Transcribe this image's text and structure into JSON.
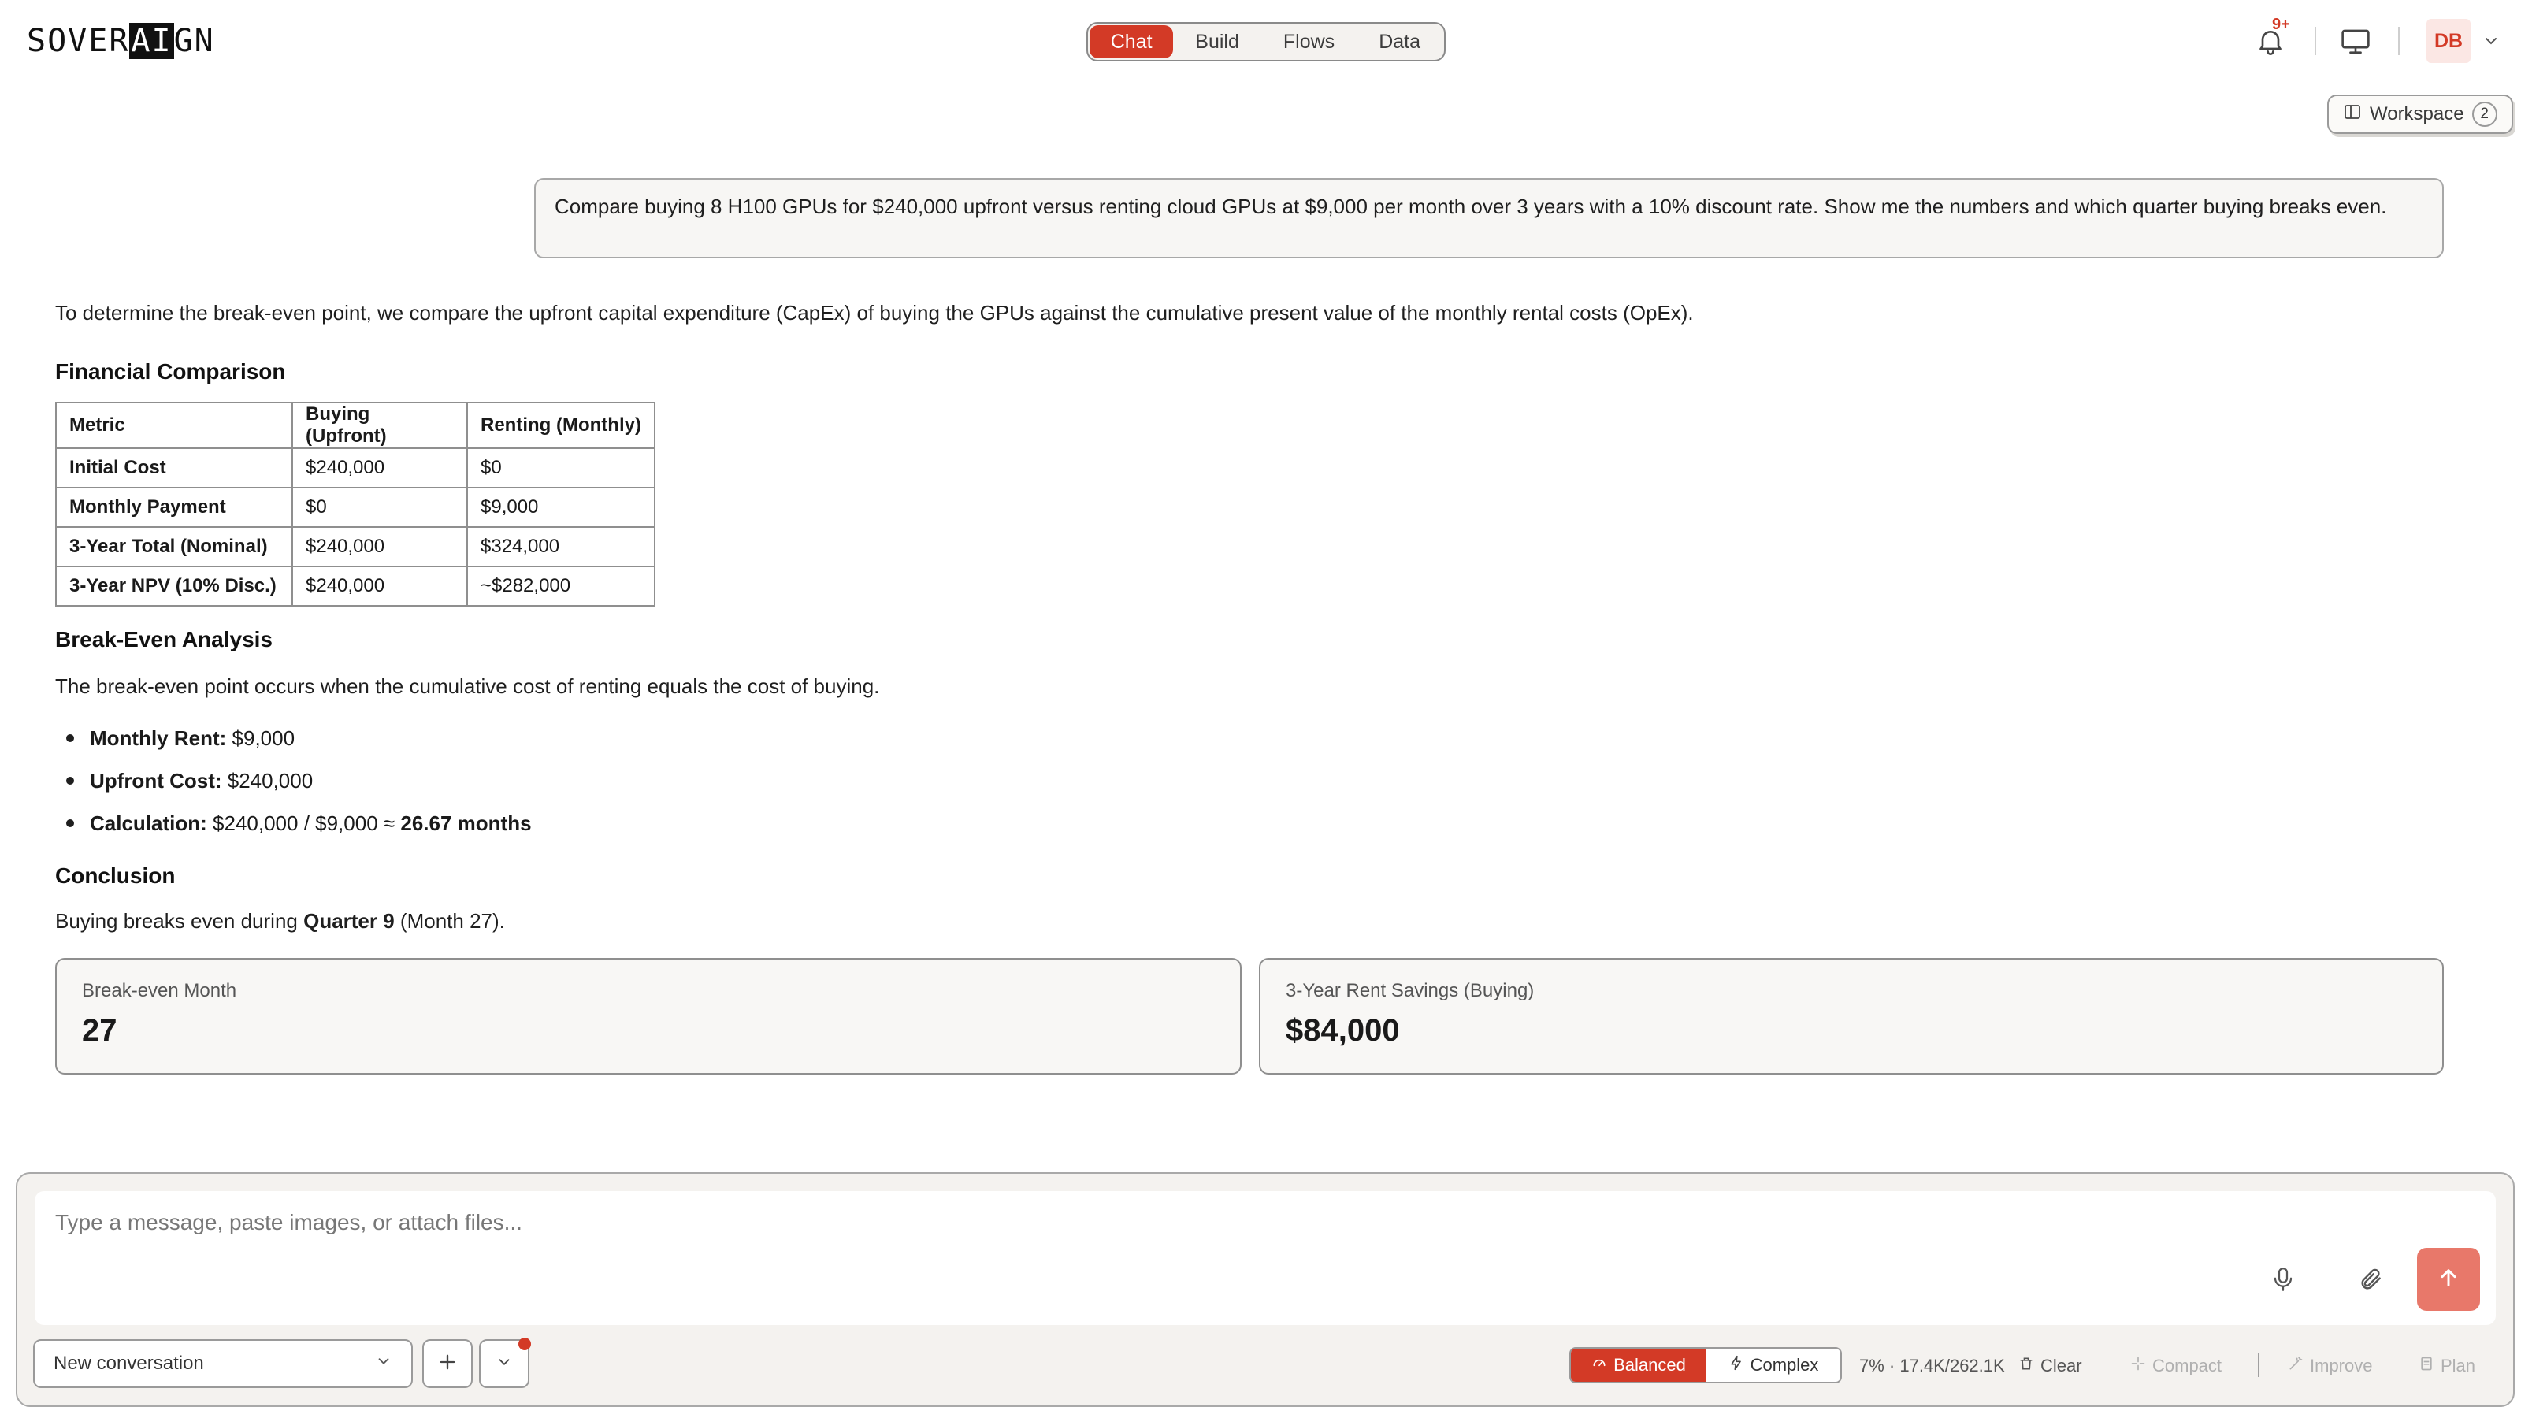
{
  "app": {
    "logo_left": "SOVER",
    "logo_invert": "AI",
    "logo_right": "GN"
  },
  "nav": {
    "tabs": [
      {
        "label": "Chat",
        "active": true
      },
      {
        "label": "Build",
        "active": false
      },
      {
        "label": "Flows",
        "active": false
      },
      {
        "label": "Data",
        "active": false
      }
    ],
    "notifications_badge": "9+",
    "avatar_initials": "DB",
    "icons": [
      "bell-icon",
      "monitor-icon",
      "chevron-down-icon"
    ]
  },
  "workspace": {
    "label": "Workspace",
    "count": "2"
  },
  "user_message": "Compare buying 8 H100 GPUs for $240,000 upfront versus renting cloud GPUs at $9,000 per month over 3 years with a 10% discount rate. Show me the numbers and which quarter buying breaks even.",
  "response": {
    "intro": "To determine the break-even point, we compare the upfront capital expenditure (CapEx) of buying the GPUs against the cumulative present value of the monthly rental costs (OpEx).",
    "financial_heading": "Financial Comparison",
    "table": {
      "headers": [
        "Metric",
        "Buying (Upfront)",
        "Renting (Monthly)"
      ],
      "rows": [
        [
          "Initial Cost",
          "$240,000",
          "$0"
        ],
        [
          "Monthly Payment",
          "$0",
          "$9,000"
        ],
        [
          "3-Year Total (Nominal)",
          "$240,000",
          "$324,000"
        ],
        [
          "3-Year NPV (10% Disc.)",
          "$240,000",
          "~$282,000"
        ]
      ]
    },
    "breakeven_heading": "Break-Even Analysis",
    "breakeven_desc": "The break-even point occurs when the cumulative cost of renting equals the cost of buying.",
    "bullets": [
      {
        "label": "Monthly Rent:",
        "value": " $9,000",
        "emph": ""
      },
      {
        "label": "Upfront Cost:",
        "value": " $240,000",
        "emph": ""
      },
      {
        "label": "Calculation:",
        "value": " $240,000 / $9,000 ≈ ",
        "emph": "26.67 months"
      }
    ],
    "conclusion_heading": "Conclusion",
    "conclusion_pre": "Buying breaks even during ",
    "conclusion_bold": "Quarter 9",
    "conclusion_post": " (Month 27).",
    "cards": [
      {
        "label": "Break-even Month",
        "value": "27"
      },
      {
        "label": "3-Year Rent Savings (Buying)",
        "value": "$84,000"
      }
    ]
  },
  "composer": {
    "placeholder": "Type a message, paste images, or attach files...",
    "value": "",
    "conversation_select": "New conversation",
    "modes": [
      {
        "label": "Balanced",
        "active": true,
        "icon": "gauge-icon"
      },
      {
        "label": "Complex",
        "active": false,
        "icon": "bolt-icon"
      }
    ],
    "stats": "7% · 17.4K/262.1K",
    "clear_label": "Clear",
    "compact_label": "Compact",
    "improve_label": "Improve",
    "plan_label": "Plan"
  },
  "colors": {
    "accent": "#d33a26",
    "send_button": "#e8786a",
    "avatar_bg": "#fbe7e4"
  }
}
